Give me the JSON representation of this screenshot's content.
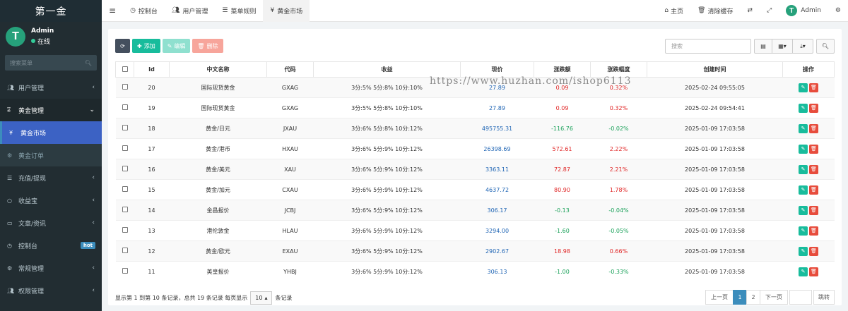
{
  "brand": "第一金",
  "user": {
    "name": "Admin",
    "status": "在线",
    "avatar_letter": "T"
  },
  "sidebar": {
    "search_placeholder": "搜索菜单",
    "items": [
      {
        "label": "用户管理",
        "icon": "users-icon",
        "state": "normal",
        "chevron": "‹"
      },
      {
        "label": "黄金管理",
        "icon": "hourglass-icon",
        "state": "open",
        "chevron": "⌄"
      },
      {
        "label": "黄金市场",
        "icon": "yen-icon",
        "state": "active",
        "chevron": ""
      },
      {
        "label": "黄金订单",
        "icon": "gear-icon",
        "state": "sub",
        "chevron": ""
      },
      {
        "label": "充值/提现",
        "icon": "list-icon",
        "state": "normal",
        "chevron": "‹"
      },
      {
        "label": "收益宝",
        "icon": "circle-icon",
        "state": "normal",
        "chevron": "‹"
      },
      {
        "label": "文章/资讯",
        "icon": "newspaper-icon",
        "state": "normal",
        "chevron": "‹"
      },
      {
        "label": "控制台",
        "icon": "dashboard-icon",
        "state": "normal",
        "chevron": "",
        "badge": "hot"
      },
      {
        "label": "常规管理",
        "icon": "cogs-icon",
        "state": "normal",
        "chevron": "‹"
      },
      {
        "label": "权限管理",
        "icon": "group-icon",
        "state": "normal",
        "chevron": "‹"
      }
    ]
  },
  "topbar": {
    "menu_icon": "≡",
    "tabs": [
      {
        "label": "控制台",
        "icon": "dashboard-icon"
      },
      {
        "label": "用户管理",
        "icon": "users-icon"
      },
      {
        "label": "菜单规则",
        "icon": "list-icon"
      },
      {
        "label": "黄金市场",
        "icon": "yen-icon",
        "active": true
      }
    ],
    "right": {
      "home": "主页",
      "clear_cache": "清除缓存",
      "admin": "Admin"
    }
  },
  "toolbar": {
    "add": "添加",
    "edit": "编辑",
    "delete": "删除"
  },
  "search": {
    "placeholder": "搜索"
  },
  "watermark": "https://www.huzhan.com/ishop6113",
  "table": {
    "columns": [
      "Id",
      "中文名称",
      "代码",
      "收益",
      "现价",
      "涨跌额",
      "涨跌幅度",
      "创建时间",
      "操作"
    ],
    "rows": [
      {
        "id": "20",
        "name": "国际现货黄金",
        "code": "GXAG",
        "profit": "3分:5% 5分:8% 10分:10%",
        "price": "27.89",
        "change": "0.09",
        "pct": "0.32%",
        "time": "2025-02-24 09:55:05",
        "dir": "up"
      },
      {
        "id": "19",
        "name": "国际现货黄金",
        "code": "GXAG",
        "profit": "3分:5% 5分:8% 10分:10%",
        "price": "27.89",
        "change": "0.09",
        "pct": "0.32%",
        "time": "2025-02-24 09:54:41",
        "dir": "up"
      },
      {
        "id": "18",
        "name": "黄金/日元",
        "code": "JXAU",
        "profit": "3分:6% 5分:8% 10分:12%",
        "price": "495755.31",
        "change": "-116.76",
        "pct": "-0.02%",
        "time": "2025-01-09 17:03:58",
        "dir": "down"
      },
      {
        "id": "17",
        "name": "黄金/港币",
        "code": "HXAU",
        "profit": "3分:6% 5分:9% 10分:12%",
        "price": "26398.69",
        "change": "572.61",
        "pct": "2.22%",
        "time": "2025-01-09 17:03:58",
        "dir": "up"
      },
      {
        "id": "16",
        "name": "黄金/美元",
        "code": "XAU",
        "profit": "3分:6% 5分:9% 10分:12%",
        "price": "3363.11",
        "change": "72.87",
        "pct": "2.21%",
        "time": "2025-01-09 17:03:58",
        "dir": "up"
      },
      {
        "id": "15",
        "name": "黄金/加元",
        "code": "CXAU",
        "profit": "3分:6% 5分:9% 10分:12%",
        "price": "4637.72",
        "change": "80.90",
        "pct": "1.78%",
        "time": "2025-01-09 17:03:58",
        "dir": "up"
      },
      {
        "id": "14",
        "name": "金昌报价",
        "code": "JCBJ",
        "profit": "3分:6% 5分:9% 10分:12%",
        "price": "306.17",
        "change": "-0.13",
        "pct": "-0.04%",
        "time": "2025-01-09 17:03:58",
        "dir": "down"
      },
      {
        "id": "13",
        "name": "港伦敦金",
        "code": "HLAU",
        "profit": "3分:6% 5分:9% 10分:12%",
        "price": "3294.00",
        "change": "-1.60",
        "pct": "-0.05%",
        "time": "2025-01-09 17:03:58",
        "dir": "down"
      },
      {
        "id": "12",
        "name": "黄金/欧元",
        "code": "EXAU",
        "profit": "3分:6% 5分:9% 10分:12%",
        "price": "2902.67",
        "change": "18.98",
        "pct": "0.66%",
        "time": "2025-01-09 17:03:58",
        "dir": "up"
      },
      {
        "id": "11",
        "name": "美皇报价",
        "code": "YHBJ",
        "profit": "3分:6% 5分:9% 10分:12%",
        "price": "306.13",
        "change": "-1.00",
        "pct": "-0.33%",
        "time": "2025-01-09 17:03:58",
        "dir": "down"
      }
    ]
  },
  "footer": {
    "summary": "显示第 1 到第 10 条记录，总共 19 条记录 每页显示",
    "page_size": "10",
    "suffix": "条记录"
  },
  "pager": {
    "prev": "上一页",
    "pages": [
      "1",
      "2"
    ],
    "current": "1",
    "next": "下一页",
    "jump": "跳转"
  },
  "colors": {
    "up": "#e02424",
    "down": "#18a058",
    "accent": "#3c8dbc"
  }
}
